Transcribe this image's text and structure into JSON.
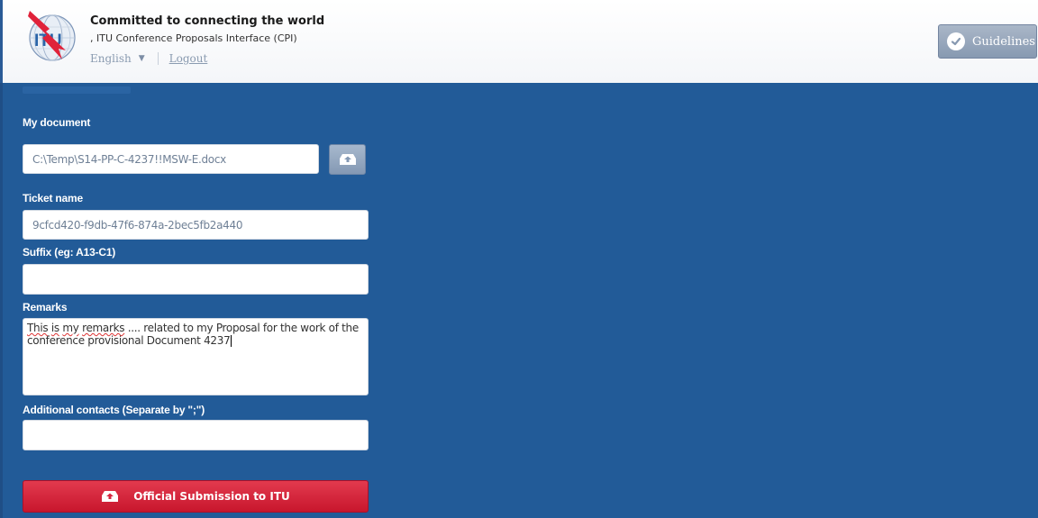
{
  "header": {
    "tagline": "Committed to connecting the world",
    "subtitle": ", ITU Conference Proposals Interface (CPI)",
    "language": "English",
    "logout_label": "Logout",
    "guidelines_label": "Guidelines",
    "logo_icon": "itu-logo"
  },
  "form": {
    "my_document": {
      "label": "My document",
      "value": "C:\\Temp\\S14-PP-C-4237!!MSW-E.docx",
      "upload_icon": "upload-icon"
    },
    "ticket_name": {
      "label": "Ticket name",
      "value": "9cfcd420-f9db-47f6-874a-2bec5fb2a440"
    },
    "suffix": {
      "label": "Suffix (eg: A13-C1)",
      "value": ""
    },
    "remarks": {
      "label": "Remarks",
      "value_line1_a": "This",
      "value_line1_b": "is",
      "value_line1_c": "my",
      "value_line1_d": "remarks",
      "value_line1_e": ".... related to my Proposal for the work of the",
      "value_line2": "conference provisional Document 4237"
    },
    "additional_contacts": {
      "label": "Additional contacts (Separate by \";\")",
      "value": ""
    },
    "submit_label": "Official Submission to ITU"
  },
  "colors": {
    "panel_blue": "#225b98",
    "submit_red": "#d52740",
    "guidelines_gray": "#8f9fb6"
  }
}
